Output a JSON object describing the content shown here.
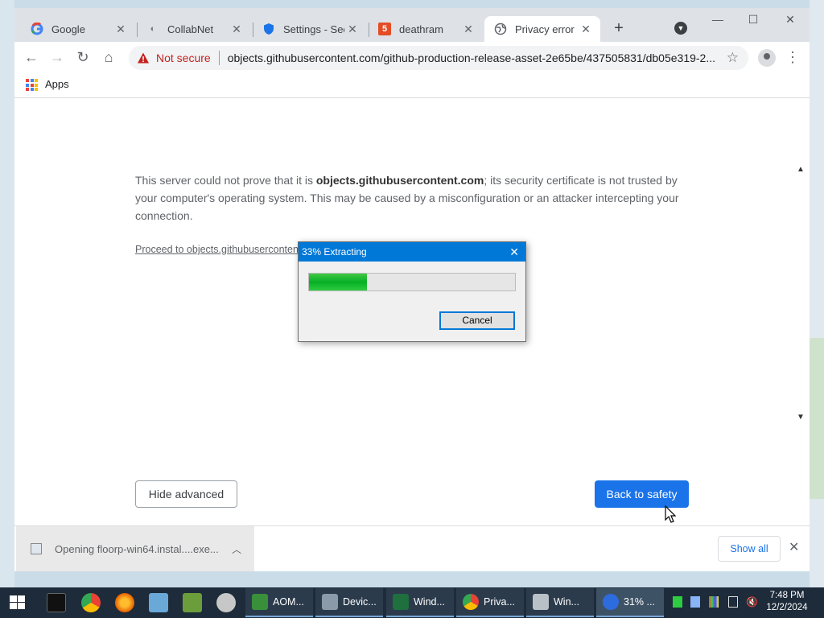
{
  "browser": {
    "tabs": [
      {
        "label": "Google",
        "icon": "google-icon"
      },
      {
        "label": "CollabNet",
        "icon": "collabnet-icon"
      },
      {
        "label": "Settings - Secu",
        "icon": "settings-shield-icon"
      },
      {
        "label": "deathram",
        "icon": "html5-icon"
      },
      {
        "label": "Privacy error",
        "icon": "globe-icon"
      }
    ],
    "omnibox": {
      "security": "Not secure",
      "url": "objects.githubusercontent.com/github-production-release-asset-2e65be/437505831/db05e319-2..."
    },
    "bookmarks": {
      "apps_label": "Apps"
    }
  },
  "page": {
    "text_prefix": "This server could not prove that it is ",
    "host_bold": "objects.githubusercontent.com",
    "text_suffix": "; its security certificate is not trusted by your computer's operating system. This may be caused by a misconfiguration or an attacker intercepting your connection.",
    "proceed_link": "Proceed to objects.githubusercontent.com (unsafe)",
    "hide_advanced": "Hide advanced",
    "back_to_safety": "Back to safety"
  },
  "downloads": {
    "item_label": "Opening floorp-win64.instal....exe...",
    "show_all": "Show all"
  },
  "dialog": {
    "title": "33% Extracting",
    "progress": 0.28,
    "cancel": "Cancel"
  },
  "taskbar": {
    "tasks": [
      {
        "label": "AOM...",
        "icon": "aomei-icon"
      },
      {
        "label": "Devic...",
        "icon": "device-manager-icon"
      },
      {
        "label": "Wind...",
        "icon": "windows-terminal-icon"
      },
      {
        "label": "Priva...",
        "icon": "chrome-icon"
      },
      {
        "label": "Win...",
        "icon": "drive-icon"
      },
      {
        "label": "31% ...",
        "icon": "extractor-icon"
      }
    ],
    "time": "7:48 PM",
    "date": "12/2/2024"
  },
  "colors": {
    "accent": "#1a73e8",
    "not_secure": "#c5221f",
    "dialog_title": "#0078d7",
    "progress_green": "#06b025",
    "taskbar": "#1d2b3a"
  }
}
